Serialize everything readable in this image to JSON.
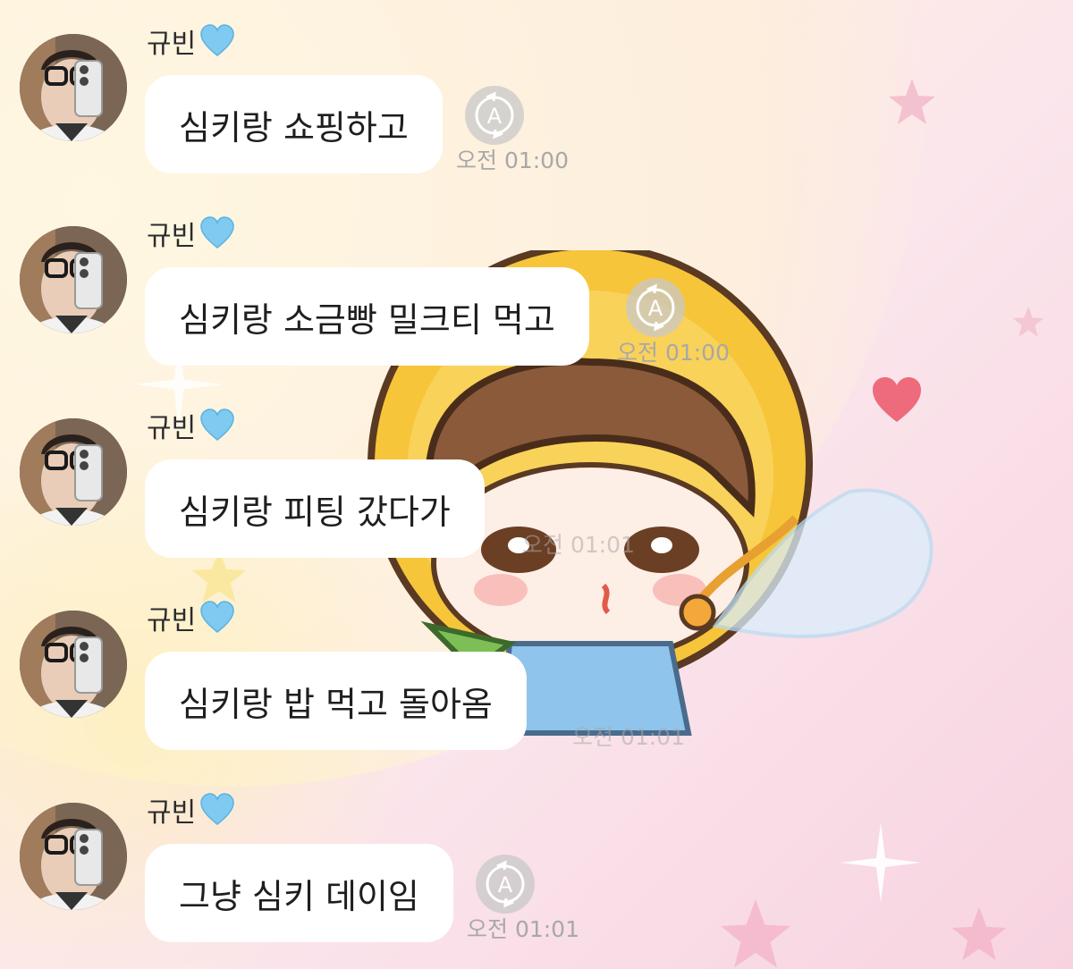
{
  "chat": {
    "messages": [
      {
        "sender": "규빈",
        "text": "심키랑 쇼핑하고",
        "time": "오전 01:00"
      },
      {
        "sender": "규빈",
        "text": "심키랑 소금빵 밀크티 먹고",
        "time": "오전 01:00"
      },
      {
        "sender": "규빈",
        "text": "심키랑 피팅 갔다가",
        "time": "오전 01:01"
      },
      {
        "sender": "규빈",
        "text": "심키랑 밥 먹고 돌아옴",
        "time": "오전 01:01"
      },
      {
        "sender": "규빈",
        "text": "그냥 심키 데이임",
        "time": "오전 01:01"
      }
    ],
    "read_icon_letter": "A",
    "colors": {
      "bubble": "#ffffff",
      "heart": "#7fcaf0",
      "time_text": "#a8a8a8",
      "background_pink": "#f7d3e0",
      "background_yellow": "#fdf3c8"
    },
    "icons": {
      "sender_badge": "blue-heart-icon",
      "read_status": "translate-a-icon"
    }
  }
}
